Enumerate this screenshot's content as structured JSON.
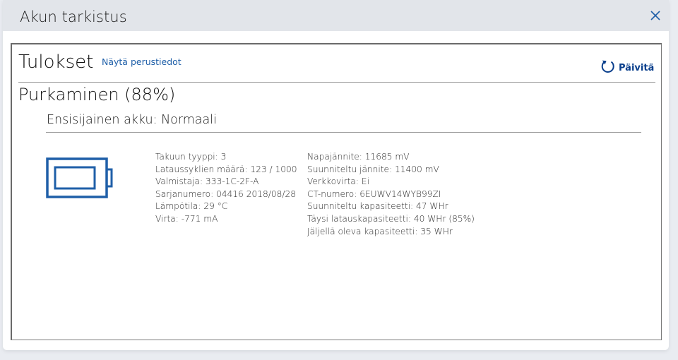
{
  "window": {
    "title": "Akun tarkistus",
    "close_icon": "close-icon"
  },
  "results": {
    "title": "Tulokset",
    "show_basic_link": "Näytä perustiedot",
    "refresh_label": "Päivitä",
    "refresh_icon": "refresh-icon",
    "status": "Purkaminen (88%)",
    "battery_heading": "Ensisijainen akku: Normaali",
    "battery_icon": "battery-icon",
    "accent_color": "#1f5fa8",
    "details_left": [
      "Takuun tyyppi: 3",
      "Lataussyklien määrä: 123 / 1000",
      "Valmistaja: 333-1C-2F-A",
      "Sarjanumero: 04416 2018/08/28",
      "Lämpötila: 29 °C",
      "Virta: -771 mA"
    ],
    "details_right": [
      "Napajännite: 11685 mV",
      "Suunniteltu jännite: 11400 mV",
      "Verkkovirta: Ei",
      "CT-numero: 6EUWV14WYB99ZI",
      "Suunniteltu kapasiteetti: 47 WHr",
      "Täysi latauskapasiteetti: 40 WHr (85%)",
      "Jäljellä oleva kapasiteetti: 35 WHr"
    ]
  }
}
